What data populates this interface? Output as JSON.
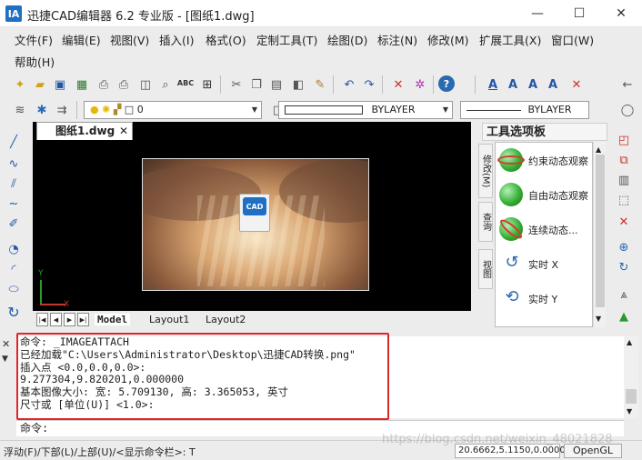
{
  "window": {
    "app_icon_text": "IA",
    "title": "迅捷CAD编辑器 6.2 专业版 - [图纸1.dwg]",
    "minimize": "—",
    "maximize": "☐",
    "close": "✕"
  },
  "menu": {
    "items": [
      "文件(F)",
      "编辑(E)",
      "视图(V)",
      "插入(I)",
      "格式(O)",
      "定制工具(T)",
      "绘图(D)",
      "标注(N)",
      "修改(M)",
      "扩展工具(X)",
      "窗口(W)",
      "帮助(H)"
    ]
  },
  "toolbar": {
    "icons": [
      "new-icon",
      "open-icon",
      "save-icon",
      "print-icon",
      "print-preview-icon",
      "cut-icon",
      "copy-icon",
      "paste-icon",
      "undo-icon",
      "redo-icon",
      "delete-icon",
      "help-icon"
    ],
    "spellcheck_label": "ABC",
    "layer_value": "0",
    "linetype_value": "BYLAYER",
    "lineweight_value": "BYLAYER",
    "text_style_icons": [
      "A",
      "A",
      "A",
      "A"
    ]
  },
  "document": {
    "tab_label": "图纸1.dwg",
    "tab_close": "✕",
    "image_icon_text": "CAD",
    "axis_x": "X",
    "axis_y": "Y"
  },
  "layouts": {
    "tabs": [
      "Model",
      "Layout1",
      "Layout2"
    ],
    "active": "Model"
  },
  "palette": {
    "title": "工具选项板",
    "vertical_tabs": [
      "修改(M)",
      "查询",
      "视图"
    ],
    "items": [
      {
        "label": "约束动态观察"
      },
      {
        "label": "自由动态观察"
      },
      {
        "label": "连续动态..."
      },
      {
        "label": "实时 X"
      },
      {
        "label": "实时 Y"
      }
    ]
  },
  "command": {
    "history": [
      "命令: _IMAGEATTACH",
      "已经加载\"C:\\Users\\Administrator\\Desktop\\迅捷CAD转换.png\"",
      "插入点 <0.0,0.0,0.0>:",
      "9.277304,9.820201,0.000000",
      "基本图像大小: 宽: 5.709130,  高: 3.365053, 英寸",
      "尺寸或 [单位(U)] <1.0>:"
    ],
    "prompt": "命令:"
  },
  "status": {
    "left_text": "浮动(F)/下部(L)/上部(U)/<显示命令栏>: T",
    "coords": "20.6662,5.1150,0.0000",
    "render_mode": "OpenGL",
    "watermark": "https://blog.csdn.net/weixin_48021828"
  }
}
